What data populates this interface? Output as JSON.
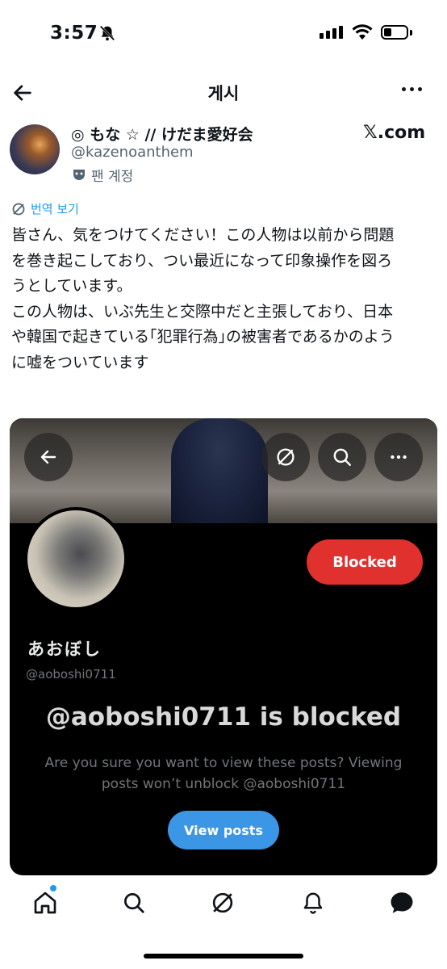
{
  "status_bar": {
    "time": "3:57"
  },
  "header": {
    "title": "게시"
  },
  "post": {
    "display_name": "◎ もな ☆ // けだま愛好会",
    "handle": "@kazenoanthem",
    "account_label": "팬 계정",
    "source": "𝕏.com",
    "translate_label": "번역 보기",
    "text": "皆さん、気をつけてください！この人物は以前から問題\nを巻き起こしており、つい最近になって印象操作を図ろ\nうとしています。\nこの人物は、いぶ先生と交際中だと主張しており、日本\nや韓国で起きている｢犯罪行為｣の被害者であるかのよう\nに嘘をついています"
  },
  "embedded": {
    "blocked_button": "Blocked",
    "profile_name": "あおぼし",
    "profile_handle": "@aoboshi0711",
    "blocked_title": "@aoboshi0711 is blocked",
    "blocked_description": "Are you sure you want to view these posts? Viewing posts won’t unblock @aoboshi0711",
    "view_button": "View posts"
  },
  "nav": {
    "items": [
      "home-icon",
      "search-icon",
      "grok-icon",
      "notifications-icon",
      "messages-icon"
    ]
  },
  "colors": {
    "accent": "#1d9bf0",
    "blocked": "#e0312e",
    "view": "#3b96e6"
  }
}
